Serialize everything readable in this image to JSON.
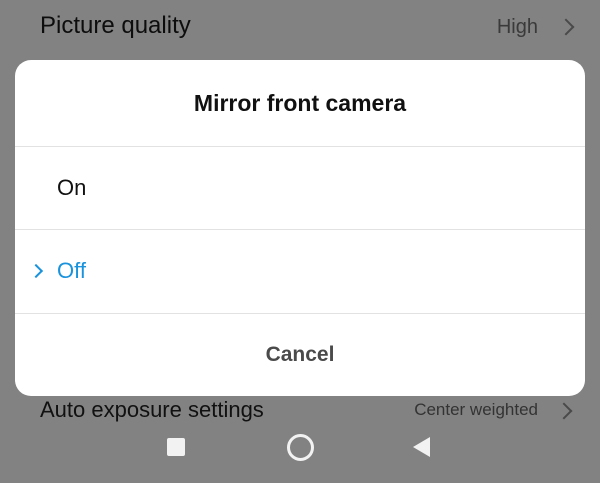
{
  "background": {
    "top_setting": {
      "label": "Picture quality",
      "value": "High"
    },
    "bottom_setting": {
      "label": "Auto exposure settings",
      "value": "Center weighted"
    }
  },
  "dialog": {
    "title": "Mirror front camera",
    "options": [
      {
        "label": "On",
        "selected": false
      },
      {
        "label": "Off",
        "selected": true
      }
    ],
    "cancel_label": "Cancel",
    "accent_color": "#1a93dd"
  },
  "navbar": {
    "icons": [
      "recents-square-icon",
      "home-circle-icon",
      "back-triangle-icon"
    ]
  }
}
